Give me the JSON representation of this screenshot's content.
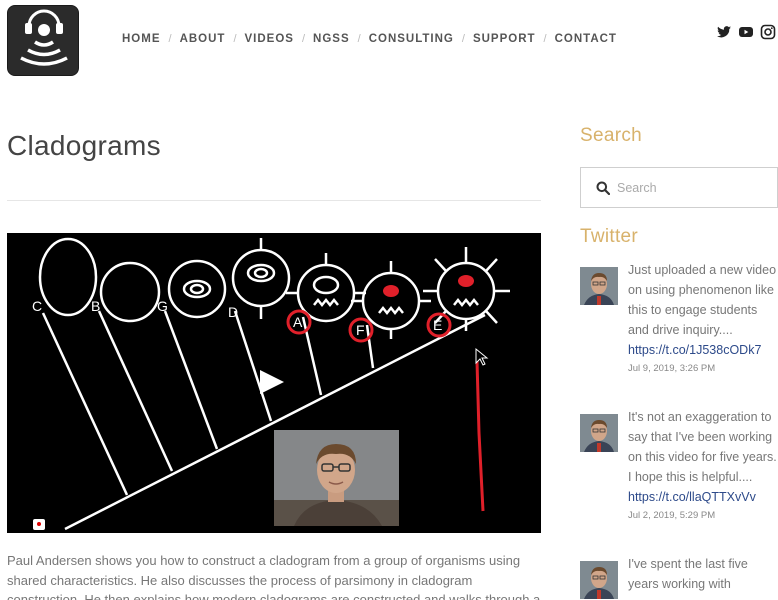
{
  "nav": {
    "items": [
      {
        "label": "HOME"
      },
      {
        "label": "ABOUT"
      },
      {
        "label": "VIDEOS"
      },
      {
        "label": "NGSS"
      },
      {
        "label": "CONSULTING"
      },
      {
        "label": "SUPPORT"
      },
      {
        "label": "CONTACT"
      }
    ]
  },
  "social": {
    "icons": [
      "twitter-icon",
      "youtube-icon",
      "instagram-icon"
    ]
  },
  "page": {
    "title": "Cladograms",
    "description": "Paul Andersen shows you how to construct a cladogram from a group of organisms using shared characteristics. He also discusses the process of parsimony in cladogram construction. He then explains how modern cladograms are constructed and walks through a cladogram of primates."
  },
  "video": {
    "labels": [
      "C",
      "B",
      "G",
      "D",
      "A",
      "F",
      "E"
    ]
  },
  "sidebar": {
    "search_title": "Search",
    "search_placeholder": "Search",
    "twitter_title": "Twitter",
    "tweets": [
      {
        "text": "Just uploaded a new video on using phenomenon like this to engage students and drive inquiry....",
        "link": "https://t.co/1J538cODk7",
        "date": "Jul 9, 2019, 3:26 PM"
      },
      {
        "text": "It's not an exaggeration to say that I've been working on this video for five years. I hope this is helpful....",
        "link": "https://t.co/llaQTTXvVv",
        "date": "Jul 2, 2019, 5:29 PM"
      },
      {
        "text": "I've spent the last five years working with",
        "link": "",
        "date": ""
      }
    ]
  },
  "colors": {
    "accent": "#d8b26b",
    "link": "#2d4a8a",
    "highlight_red": "#e0202a"
  }
}
